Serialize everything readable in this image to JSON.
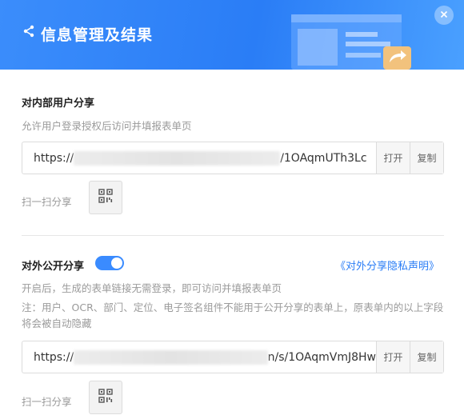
{
  "header": {
    "title": "信息管理及结果",
    "icon": "share-icon",
    "close_icon": "close-icon"
  },
  "internal_share": {
    "title": "对内部用户分享",
    "description": "允许用户登录授权后访问并填报表单页",
    "url_prefix": "https://",
    "url_suffix": "/1OAqmUTh3Lc",
    "open_label": "打开",
    "copy_label": "复制",
    "scan_label": "扫一扫分享",
    "qr_icon": "qr-code-icon"
  },
  "public_share": {
    "title": "对外公开分享",
    "toggle_on": true,
    "privacy_link": "《对外分享隐私声明》",
    "description": "开启后，生成的表单链接无需登录，即可访问并填报表单页",
    "note": "注：用户、OCR、部门、定位、电子签名组件不能用于公开分享的表单上，原表单内的以上字段将会被自动隐藏",
    "url_prefix": "https://",
    "url_suffix": "n/s/1OAqmVmJ8Hw",
    "open_label": "打开",
    "copy_label": "复制",
    "scan_label": "扫一扫分享",
    "qr_icon": "qr-code-icon"
  },
  "colors": {
    "accent": "#2a7df6",
    "header_gradient_start": "#3b8dfb",
    "header_gradient_end": "#4aa0ff"
  }
}
